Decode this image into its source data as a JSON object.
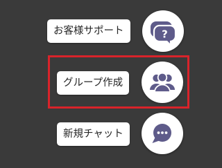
{
  "theme": {
    "background": "#3a3a3a",
    "icon_color": "#5e5b8a",
    "highlight_color": "#d9232a"
  },
  "actions": [
    {
      "label": "お客様サポート",
      "icon": "help-chat-icon"
    },
    {
      "label": "グループ作成",
      "icon": "group-people-icon",
      "highlighted": true
    },
    {
      "label": "新規チャット",
      "icon": "chat-bubble-icon"
    }
  ]
}
